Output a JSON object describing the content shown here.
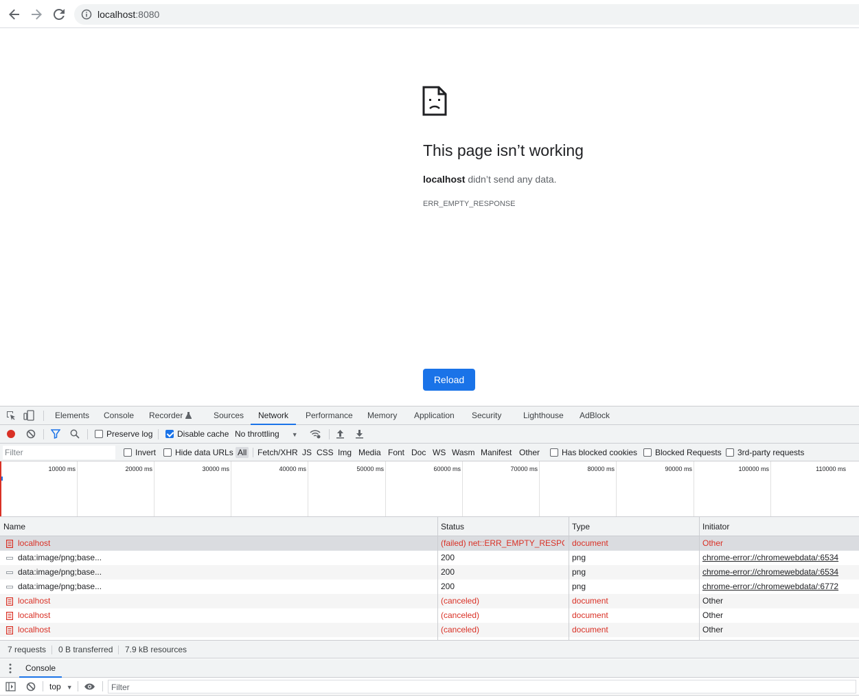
{
  "browser": {
    "url_host": "localhost",
    "url_port": ":8080"
  },
  "error_page": {
    "title": "This page isn’t working",
    "desc_bold": "localhost",
    "desc_rest": " didn’t send any data.",
    "code": "ERR_EMPTY_RESPONSE",
    "reload_label": "Reload"
  },
  "devtools": {
    "tabs": [
      "Elements",
      "Console",
      "Recorder",
      "Sources",
      "Network",
      "Performance",
      "Memory",
      "Application",
      "Security",
      "Lighthouse",
      "AdBlock"
    ],
    "active_tab": "Network",
    "network_bar": {
      "preserve_log": "Preserve log",
      "disable_cache": "Disable cache",
      "throttling": "No throttling"
    },
    "filter_bar": {
      "placeholder": "Filter",
      "invert": "Invert",
      "hide_data_urls": "Hide data URLs",
      "types": [
        "All",
        "Fetch/XHR",
        "JS",
        "CSS",
        "Img",
        "Media",
        "Font",
        "Doc",
        "WS",
        "Wasm",
        "Manifest",
        "Other"
      ],
      "has_blocked_cookies": "Has blocked cookies",
      "blocked_requests": "Blocked Requests",
      "third_party": "3rd-party requests"
    },
    "timeline": {
      "labels": [
        "10000 ms",
        "20000 ms",
        "30000 ms",
        "40000 ms",
        "50000 ms",
        "60000 ms",
        "70000 ms",
        "80000 ms",
        "90000 ms",
        "100000 ms",
        "110000 ms"
      ]
    },
    "table": {
      "headers": {
        "name": "Name",
        "status": "Status",
        "type": "Type",
        "initiator": "Initiator"
      },
      "rows": [
        {
          "name": "localhost",
          "status": "(failed) net::ERR_EMPTY_RESPO...",
          "type": "document",
          "initiator": "Other",
          "error": true
        },
        {
          "name": "data:image/png;base...",
          "status": "200",
          "type": "png",
          "initiator": "chrome-error://chromewebdata/:6534",
          "error": false
        },
        {
          "name": "data:image/png;base...",
          "status": "200",
          "type": "png",
          "initiator": "chrome-error://chromewebdata/:6534",
          "error": false
        },
        {
          "name": "data:image/png;base...",
          "status": "200",
          "type": "png",
          "initiator": "chrome-error://chromewebdata/:6772",
          "error": false
        },
        {
          "name": "localhost",
          "status": "(canceled)",
          "type": "document",
          "initiator": "Other",
          "error": true
        },
        {
          "name": "localhost",
          "status": "(canceled)",
          "type": "document",
          "initiator": "Other",
          "error": true
        },
        {
          "name": "localhost",
          "status": "(canceled)",
          "type": "document",
          "initiator": "Other",
          "error": true
        }
      ]
    },
    "summary": {
      "requests": "7 requests",
      "transferred": "0 B transferred",
      "resources": "7.9 kB resources"
    },
    "drawer": {
      "tab": "Console",
      "context": "top",
      "filter_placeholder": "Filter"
    }
  }
}
